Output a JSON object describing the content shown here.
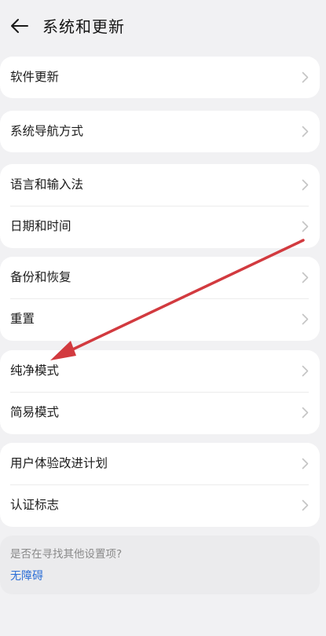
{
  "header": {
    "title": "系统和更新",
    "back_icon": "arrow-left-icon"
  },
  "groups": [
    {
      "items": [
        {
          "label": "软件更新"
        }
      ]
    },
    {
      "items": [
        {
          "label": "系统导航方式"
        }
      ]
    },
    {
      "items": [
        {
          "label": "语言和输入法"
        },
        {
          "label": "日期和时间"
        }
      ]
    },
    {
      "items": [
        {
          "label": "备份和恢复"
        },
        {
          "label": "重置"
        }
      ]
    },
    {
      "items": [
        {
          "label": "纯净模式"
        },
        {
          "label": "简易模式"
        }
      ]
    },
    {
      "items": [
        {
          "label": "用户体验改进计划"
        },
        {
          "label": "认证标志"
        }
      ]
    }
  ],
  "search_suggestion": {
    "question": "是否在寻找其他设置项?",
    "link": "无障碍"
  },
  "colors": {
    "background": "#f1f1f3",
    "link": "#2d6fd6",
    "annotation_arrow": "#d23a3f"
  }
}
